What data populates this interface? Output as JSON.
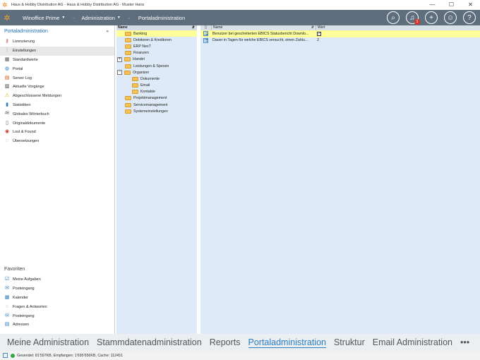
{
  "window": {
    "title": "Haus & Hobby Distribution AG - Haus & Hobby Distribution AG - Muster Hans",
    "minimize": "—",
    "maximize": "☐",
    "close": "✕"
  },
  "navbar": {
    "app_menu": "Winoffice Prime",
    "admin_menu": "Administration",
    "breadcrumb": "Portaladministration",
    "notification_count": "1",
    "icons": [
      "search-icon",
      "bell-icon",
      "plus-icon",
      "user-icon",
      "help-icon"
    ]
  },
  "sidebar": {
    "title": "Portaladministration",
    "collapse": "«",
    "items": [
      {
        "label": "Lizenzierung",
        "icon": "key-icon",
        "glyph": "⚷",
        "color": "#c0392b"
      },
      {
        "label": "Einstellungen",
        "icon": "sliders-icon",
        "glyph": "⫶",
        "color": "#333333"
      },
      {
        "label": "Standardwerte",
        "icon": "grid-icon",
        "glyph": "▦",
        "color": "#555555"
      },
      {
        "label": "Portal",
        "icon": "globe-icon",
        "glyph": "◍",
        "color": "#2a7dbf"
      },
      {
        "label": "Server Log",
        "icon": "log-icon",
        "glyph": "▤",
        "color": "#d35400"
      },
      {
        "label": "Aktuelle Vorgänge",
        "icon": "list-icon",
        "glyph": "▥",
        "color": "#333333"
      },
      {
        "label": "Abgeschlossene Meldungen",
        "icon": "warning-icon",
        "glyph": "⚠",
        "color": "#e0a800"
      },
      {
        "label": "Statistiken",
        "icon": "chart-icon",
        "glyph": "▮",
        "color": "#2a7dbf"
      },
      {
        "label": "Globales Wörterbuch",
        "icon": "abc-icon",
        "glyph": "ᴬᴮ",
        "color": "#555555"
      },
      {
        "label": "Originaldokumente",
        "icon": "document-icon",
        "glyph": "▯",
        "color": "#555555"
      },
      {
        "label": "Lost & Found",
        "icon": "lifebuoy-icon",
        "glyph": "◉",
        "color": "#c0392b"
      },
      {
        "label": "Übersetzungen",
        "icon": "speech-icon",
        "glyph": "◌",
        "color": "#8e44ad"
      }
    ],
    "favorites_title": "Favoriten",
    "favorites": [
      {
        "label": "Meine Aufgaben",
        "icon": "tasks-icon",
        "glyph": "☑",
        "color": "#2a7dbf"
      },
      {
        "label": "Posteingang",
        "icon": "inbox-icon",
        "glyph": "✉",
        "color": "#2a7dbf"
      },
      {
        "label": "Kalender",
        "icon": "calendar-icon",
        "glyph": "▦",
        "color": "#2a7dbf"
      },
      {
        "label": "Fragen & Antworten",
        "icon": "question-icon",
        "glyph": "◌",
        "color": "#2a7dbf"
      },
      {
        "label": "Posteingang",
        "icon": "inbox-icon",
        "glyph": "✉",
        "color": "#2a7dbf"
      },
      {
        "label": "Adressen",
        "icon": "address-icon",
        "glyph": "▤",
        "color": "#2a7dbf"
      }
    ]
  },
  "tree": {
    "header": "Name",
    "sort": "⇵",
    "nodes": [
      {
        "label": "Banking",
        "level": 0,
        "expander": "",
        "selected": true
      },
      {
        "label": "Debitoren & Kreditoren",
        "level": 0,
        "expander": ""
      },
      {
        "label": "ERP NexT",
        "level": 0,
        "expander": ""
      },
      {
        "label": "Finanzen",
        "level": 0,
        "expander": ""
      },
      {
        "label": "Handel",
        "level": 0,
        "expander": "+"
      },
      {
        "label": "Leistungen & Spesen",
        "level": 0,
        "expander": ""
      },
      {
        "label": "Organizer",
        "level": 0,
        "expander": "−"
      },
      {
        "label": "Dokumente",
        "level": 1,
        "expander": ""
      },
      {
        "label": "Email",
        "level": 1,
        "expander": ""
      },
      {
        "label": "Kontakte",
        "level": 1,
        "expander": ""
      },
      {
        "label": "Projektmanagement",
        "level": 0,
        "expander": ""
      },
      {
        "label": "Servicemanagement",
        "level": 0,
        "expander": ""
      },
      {
        "label": "Systemeinstellungen",
        "level": 0,
        "expander": ""
      }
    ]
  },
  "grid": {
    "col_name": "Name",
    "col_value": "Wert",
    "sort": "⇵",
    "rows": [
      {
        "name": "Benutzer bei gescheiterten EBICS Statusbericht Downlo...",
        "value": "✓",
        "is_checkbox": true,
        "selected": true
      },
      {
        "name": "Dauer in Tagen für welche EBICS versucht, einen Zahlu...",
        "value": "2",
        "is_checkbox": false
      }
    ]
  },
  "modules": {
    "items": [
      "Meine Administration",
      "Stammdatenadministration",
      "Reports",
      "Portaladministration",
      "Struktur",
      "Email Administration"
    ],
    "active": "Portaladministration",
    "more": "•••"
  },
  "status": {
    "text": "Gesendet: 81'597KB, Empfangen: 1'695'656KB, Cache: 112451"
  },
  "colors": {
    "navbar": "#5f6e7d",
    "accent": "#2a7dbf",
    "panel_bg": "#deeaf7",
    "selection": "#ffff99"
  }
}
